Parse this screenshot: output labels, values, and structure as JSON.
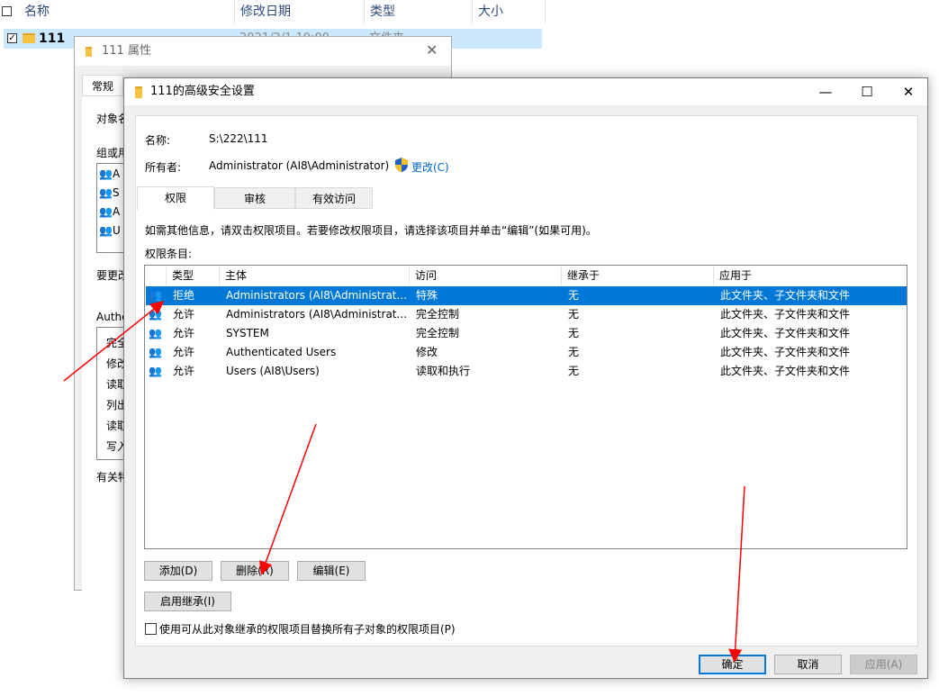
{
  "explorer": {
    "columns": [
      "名称",
      "修改日期",
      "类型",
      "大小"
    ],
    "row": {
      "name": "111",
      "date": "2021/2/1 10:00",
      "type": "文件夹"
    }
  },
  "properties": {
    "title": "111 属性",
    "tab_general": "常规",
    "labels": [
      "对象名",
      "组或用",
      "要更改",
      "Authe",
      "有关特"
    ],
    "group_items": [
      "A",
      "S",
      "A",
      "U"
    ],
    "perm_items": [
      "完全",
      "修改",
      "读取",
      "列出",
      "读取",
      "写入"
    ]
  },
  "dialog": {
    "title": "111的高级安全设置",
    "name_label": "名称:",
    "name_value": "S:\\222\\111",
    "owner_label": "所有者:",
    "owner_value": "Administrator (AI8\\Administrator)",
    "change_link": "更改(C)",
    "tabs": [
      "权限",
      "审核",
      "有效访问"
    ],
    "info_text": "如需其他信息，请双击权限项目。若要修改权限项目，请选择该项目并单击“编辑”(如果可用)。",
    "entries_label": "权限条目:",
    "columns": [
      "类型",
      "主体",
      "访问",
      "继承于",
      "应用于"
    ],
    "rows": [
      {
        "type": "拒绝",
        "principal": "Administrators (AI8\\Administrat...",
        "access": "特殊",
        "inherited": "无",
        "applies": "此文件夹、子文件夹和文件"
      },
      {
        "type": "允许",
        "principal": "Administrators (AI8\\Administrat...",
        "access": "完全控制",
        "inherited": "无",
        "applies": "此文件夹、子文件夹和文件"
      },
      {
        "type": "允许",
        "principal": "SYSTEM",
        "access": "完全控制",
        "inherited": "无",
        "applies": "此文件夹、子文件夹和文件"
      },
      {
        "type": "允许",
        "principal": "Authenticated Users",
        "access": "修改",
        "inherited": "无",
        "applies": "此文件夹、子文件夹和文件"
      },
      {
        "type": "允许",
        "principal": "Users (AI8\\Users)",
        "access": "读取和执行",
        "inherited": "无",
        "applies": "此文件夹、子文件夹和文件"
      }
    ],
    "buttons": {
      "add": "添加(D)",
      "remove": "删除(R)",
      "edit": "编辑(E)",
      "inherit": "启用继承(I)"
    },
    "replace_checkbox": "使用可从此对象继承的权限项目替换所有子对象的权限项目(P)",
    "ok": "确定",
    "cancel": "取消",
    "apply": "应用(A)"
  },
  "colors": {
    "accent": "#0078d7",
    "arrow": "#ff0000"
  }
}
